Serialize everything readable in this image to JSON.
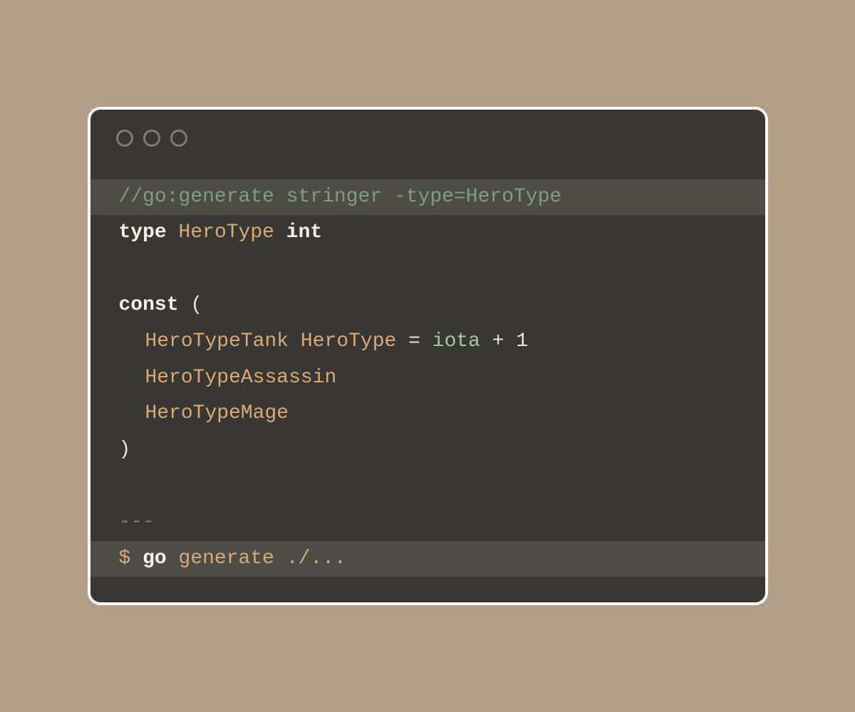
{
  "code": {
    "comment": "//go:generate stringer -type=HeroType",
    "kw_type": "type",
    "typename": "HeroType",
    "kw_int": "int",
    "kw_const": "const",
    "lparen": "(",
    "tank": "HeroTypeTank",
    "tank_type": "HeroType",
    "eq": "=",
    "iota": "iota",
    "plus": "+",
    "one": "1",
    "assassin": "HeroTypeAssassin",
    "mage": "HeroTypeMage",
    "rparen": ")",
    "sep": "---",
    "prompt": "$",
    "cmd": "go",
    "arg1": "generate",
    "arg2": "./..."
  }
}
